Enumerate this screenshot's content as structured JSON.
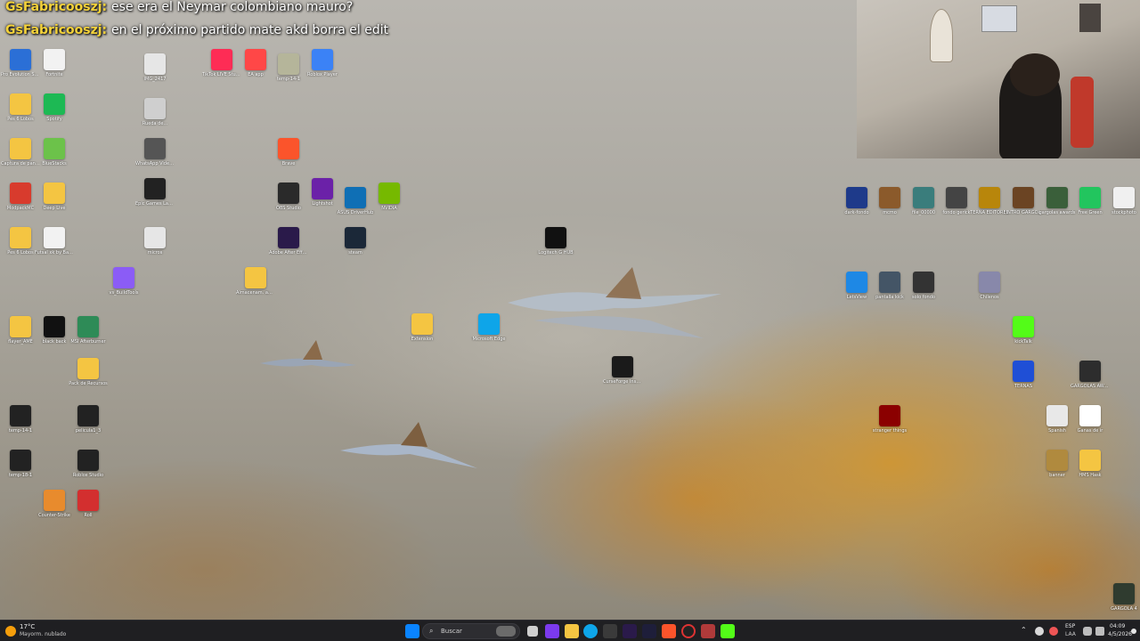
{
  "chat": [
    {
      "user": "GsFabricooszj:",
      "message": "ese era el Neymar colombiano mauro?"
    },
    {
      "user": "GsFabricooszj:",
      "message": "en el próximo partido mate akd borra el edit"
    }
  ],
  "desktop_icons": [
    {
      "label": "Pro Evolution Soccer",
      "color": "#2b6fd6",
      "icon": "game-icon"
    },
    {
      "label": "Fortnite",
      "color": "#f2f2f2",
      "icon": "file-icon"
    },
    {
      "label": "Pes 6 Lobos",
      "color": "#f4c542",
      "icon": "folder-icon"
    },
    {
      "label": "Spotify",
      "color": "#1db954",
      "icon": "spotify-icon"
    },
    {
      "label": "Captura de pantalla",
      "color": "#f4c542",
      "icon": "folder-icon"
    },
    {
      "label": "BlueStacks",
      "color": "#6cc24a",
      "icon": "bluestacks-icon"
    },
    {
      "label": "ModpackMC",
      "color": "#d83b2d",
      "icon": "app-icon"
    },
    {
      "label": "Deep Live",
      "color": "#f4c542",
      "icon": "folder-icon"
    },
    {
      "label": "Pes 6 Lobos",
      "color": "#f4c542",
      "icon": "folder-icon"
    },
    {
      "label": "Futsal xk by Balinga",
      "color": "#f2f2f2",
      "icon": "file-icon"
    },
    {
      "label": "IMG_2417",
      "color": "#e6e6e6",
      "icon": "image-icon"
    },
    {
      "label": "Rueda de...",
      "color": "#cfcfcf",
      "icon": "image-icon"
    },
    {
      "label": "WhatsApp Video 2025",
      "color": "#555555",
      "icon": "video-icon"
    },
    {
      "label": "Epic Games Launcher",
      "color": "#222222",
      "icon": "epic-icon"
    },
    {
      "label": "micros",
      "color": "#e6e6e6",
      "icon": "image-icon"
    },
    {
      "label": "TikTok LIVE Studio",
      "color": "#fe2c55",
      "icon": "tiktok-icon"
    },
    {
      "label": "EA app",
      "color": "#ff4747",
      "icon": "ea-icon"
    },
    {
      "label": "temp-14-1",
      "color": "#b5b59a",
      "icon": "image-icon"
    },
    {
      "label": "Roblox Player",
      "color": "#3b82f6",
      "icon": "roblox-icon"
    },
    {
      "label": "vs_BuildTools",
      "color": "#8b5cf6",
      "icon": "vs-icon"
    },
    {
      "label": "Almacenam. automatic",
      "color": "#f4c542",
      "icon": "folder-icon"
    },
    {
      "label": "flayer_AME",
      "color": "#f4c542",
      "icon": "folder-icon"
    },
    {
      "label": "black back",
      "color": "#111111",
      "icon": "image-icon"
    },
    {
      "label": "MSI Afterburner",
      "color": "#2e8b57",
      "icon": "msi-icon"
    },
    {
      "label": "Pack de Recursos",
      "color": "#f4c542",
      "icon": "folder-icon"
    },
    {
      "label": "temp-14-1",
      "color": "#222222",
      "icon": "image-icon"
    },
    {
      "label": "pelicula1_3",
      "color": "#222222",
      "icon": "video-icon"
    },
    {
      "label": "temp-18-1",
      "color": "#222222",
      "icon": "image-icon"
    },
    {
      "label": "Roblox Studio",
      "color": "#222222",
      "icon": "roblox-studio-icon"
    },
    {
      "label": "Counter-Strike",
      "color": "#e88b2d",
      "icon": "cs-icon"
    },
    {
      "label": "Roll",
      "color": "#d32f2f",
      "icon": "app-icon"
    },
    {
      "label": "Extension",
      "color": "#f4c542",
      "icon": "folder-icon"
    },
    {
      "label": "Microsoft Edge",
      "color": "#0ea5e9",
      "icon": "edge-icon"
    },
    {
      "label": "CurseForge Installer",
      "color": "#1a1a1a",
      "icon": "curseforge-icon"
    },
    {
      "label": "Logitech G HUB",
      "color": "#111111",
      "icon": "logitech-icon"
    },
    {
      "label": "OBS Studio",
      "color": "#2a2a2a",
      "icon": "obs-icon"
    },
    {
      "label": "Brave",
      "color": "#fb542b",
      "icon": "brave-icon"
    },
    {
      "label": "steam",
      "color": "#1b2838",
      "icon": "steam-icon"
    },
    {
      "label": "Lightshot",
      "color": "#6b21a8",
      "icon": "app-icon"
    },
    {
      "label": "Adobe After Effects",
      "color": "#2a1a4a",
      "icon": "ae-icon"
    },
    {
      "label": "NVIDIA",
      "color": "#76b900",
      "icon": "nvidia-icon"
    },
    {
      "label": "ASUS DriverHub",
      "color": "#0f6fb5",
      "icon": "asus-icon"
    }
  ],
  "right_icons": [
    {
      "label": "dark-fondo",
      "color": "#1e3a8a",
      "icon": "image-icon"
    },
    {
      "label": "mcmo",
      "color": "#8b5a2b",
      "icon": "image-icon"
    },
    {
      "label": "file_00000",
      "color": "#3a7d7c",
      "icon": "image-icon"
    },
    {
      "label": "fondo gerick",
      "color": "#444444",
      "icon": "image-icon"
    },
    {
      "label": "TERNA EDITORES",
      "color": "#b8860b",
      "icon": "image-icon"
    },
    {
      "label": "INTRO GARGOL",
      "color": "#6b4423",
      "icon": "image-icon"
    },
    {
      "label": "gargolas awards",
      "color": "#3a5f3a",
      "icon": "image-icon"
    },
    {
      "label": "Free Green",
      "color": "#22c55e",
      "icon": "image-icon"
    },
    {
      "label": "stockphoto",
      "color": "#f0f0f0",
      "icon": "image-icon"
    },
    {
      "label": "LetsView",
      "color": "#1e88e5",
      "icon": "app-icon"
    },
    {
      "label": "pantalla kick",
      "color": "#445566",
      "icon": "image-icon"
    },
    {
      "label": "solo fondo",
      "color": "#333333",
      "icon": "image-icon"
    },
    {
      "label": "Chilenos",
      "color": "#8888aa",
      "icon": "image-icon"
    },
    {
      "label": "kickTalk",
      "color": "#53fc18",
      "icon": "kick-icon"
    },
    {
      "label": "TERNAS",
      "color": "#1f4fd6",
      "icon": "ae-icon"
    },
    {
      "label": "GARGOLAS AWARDS",
      "color": "#2d2d2d",
      "icon": "image-icon"
    },
    {
      "label": "stranger things",
      "color": "#8b0000",
      "icon": "image-icon"
    },
    {
      "label": "Spanish",
      "color": "#e8e8e8",
      "icon": "file-icon"
    },
    {
      "label": "Ganas de ir",
      "color": "#ffffff",
      "icon": "app-icon"
    },
    {
      "label": "banner",
      "color": "#b08a3e",
      "icon": "image-icon"
    },
    {
      "label": "HMS Hask",
      "color": "#f4c542",
      "icon": "folder-icon"
    },
    {
      "label": "GARGOLA 4",
      "color": "#2f3b2f",
      "icon": "image-icon"
    }
  ],
  "taskbar": {
    "weather_temp": "17°C",
    "weather_desc": "Mayorm. nublado",
    "search_placeholder": "Buscar",
    "lang": "ESP",
    "lang_sub": "LAA",
    "time": "04:09",
    "date": "4/5/2026"
  },
  "colors": {
    "taskbar": "#1f1f22",
    "chat_user": "#f4d23a",
    "folder": "#f4c542"
  }
}
